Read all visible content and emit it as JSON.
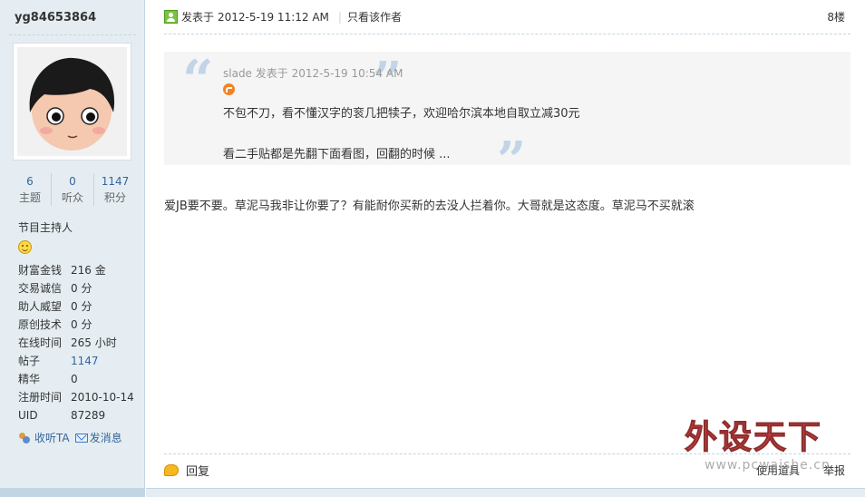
{
  "user": {
    "name": "yg84653864",
    "stats": [
      {
        "value": "6",
        "label": "主题"
      },
      {
        "value": "0",
        "label": "听众"
      },
      {
        "value": "1147",
        "label": "积分"
      }
    ],
    "rank": "节目主持人",
    "info": [
      {
        "key": "财富金钱",
        "value": "216 金"
      },
      {
        "key": "交易诚信",
        "value": "0 分"
      },
      {
        "key": "助人威望",
        "value": "0 分"
      },
      {
        "key": "原创技术",
        "value": "0 分"
      },
      {
        "key": "在线时间",
        "value": "265 小时"
      },
      {
        "key": "帖子",
        "value": "1147"
      },
      {
        "key": "精华",
        "value": "0"
      },
      {
        "key": "注册时间",
        "value": "2010-10-14"
      },
      {
        "key": "UID",
        "value": "87289"
      }
    ],
    "actions": {
      "follow": "收听TA",
      "message": "发消息"
    }
  },
  "post": {
    "posted_prefix": "发表于",
    "posted_time": "2012-5-19 11:12 AM",
    "only_author": "只看该作者",
    "floor": "8楼",
    "quote": {
      "author": "slade 发表于 2012-5-19 10:54 AM",
      "line1": "不包不刀，看不懂汉字的衮几把犊子，欢迎哈尔滨本地自取立减30元",
      "line2": "看二手贴都是先翻下面看图，回翻的时候 ..."
    },
    "body": "爱JB要不要。草泥马我非让你要了？有能耐你买新的去没人拦着你。大哥就是这态度。草泥马不买就滚",
    "reply": "回复",
    "use_tool": "使用道具",
    "report": "举报"
  },
  "watermark": {
    "main": "外设天下",
    "sub": "www.pcwaishe.cn"
  },
  "colors": {
    "sidebar_bg": "#e5edf2",
    "link": "#336699",
    "border": "#c2d5e3",
    "quote_bg": "#f5f5f5"
  }
}
